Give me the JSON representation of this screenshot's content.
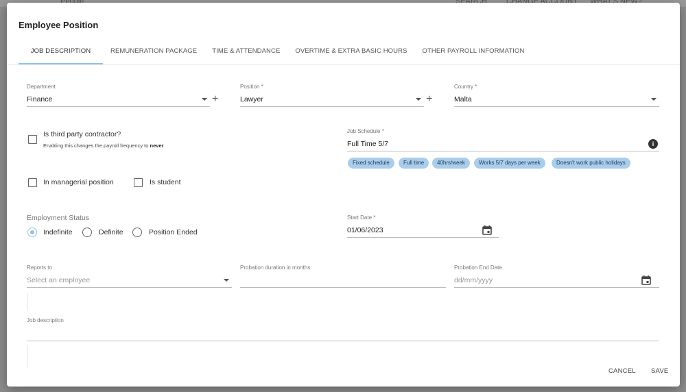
{
  "background": {
    "items": [
      "People",
      "SEARCH",
      "CHANGE ACCOUNT",
      "WHAT'S NEW?"
    ]
  },
  "dialog": {
    "title": "Employee Position",
    "tabs": [
      {
        "label": "JOB DESCRIPTION",
        "active": true
      },
      {
        "label": "REMUNERATION PACKAGE",
        "active": false
      },
      {
        "label": "TIME & ATTENDANCE",
        "active": false
      },
      {
        "label": "OVERTIME & EXTRA BASIC HOURS",
        "active": false
      },
      {
        "label": "OTHER PAYROLL INFORMATION",
        "active": false
      }
    ],
    "department": {
      "label": "Department",
      "value": "Finance"
    },
    "position": {
      "label": "Position *",
      "value": "Lawyer"
    },
    "country": {
      "label": "Country *",
      "value": "Malta"
    },
    "third_party": {
      "label": "Is third party contractor?",
      "hint_prefix": "Enabling this changes the payroll frequency to",
      "hint_bold": "never",
      "checked": false
    },
    "job_schedule": {
      "label": "Job Schedule *",
      "value": "Full Time 5/7",
      "tags": [
        "Fixed schedule",
        "Full time",
        "40hrs/week",
        "Works 5/7 days per week",
        "Doesn't work public holidays"
      ]
    },
    "managerial": {
      "label": "In managerial position",
      "checked": false
    },
    "student": {
      "label": "Is student",
      "checked": false
    },
    "employment_status": {
      "label": "Employment Status",
      "options": [
        "Indefinite",
        "Definite",
        "Position Ended"
      ],
      "selected": "Indefinite"
    },
    "start_date": {
      "label": "Start Date *",
      "value": "01/06/2023"
    },
    "reports_to": {
      "label": "Reports to",
      "placeholder": "Select an employee"
    },
    "probation_duration": {
      "label": "Probation duration in months",
      "value": ""
    },
    "probation_end": {
      "label": "Probation End Date",
      "placeholder": "dd/mm/yyyy"
    },
    "job_description": {
      "label": "Job description",
      "value": ""
    },
    "actions": {
      "cancel": "CANCEL",
      "save": "SAVE"
    }
  },
  "colors": {
    "accent": "#90c2e6",
    "chip_bg": "#a9cdea",
    "overlay": "#8d8d8d"
  }
}
